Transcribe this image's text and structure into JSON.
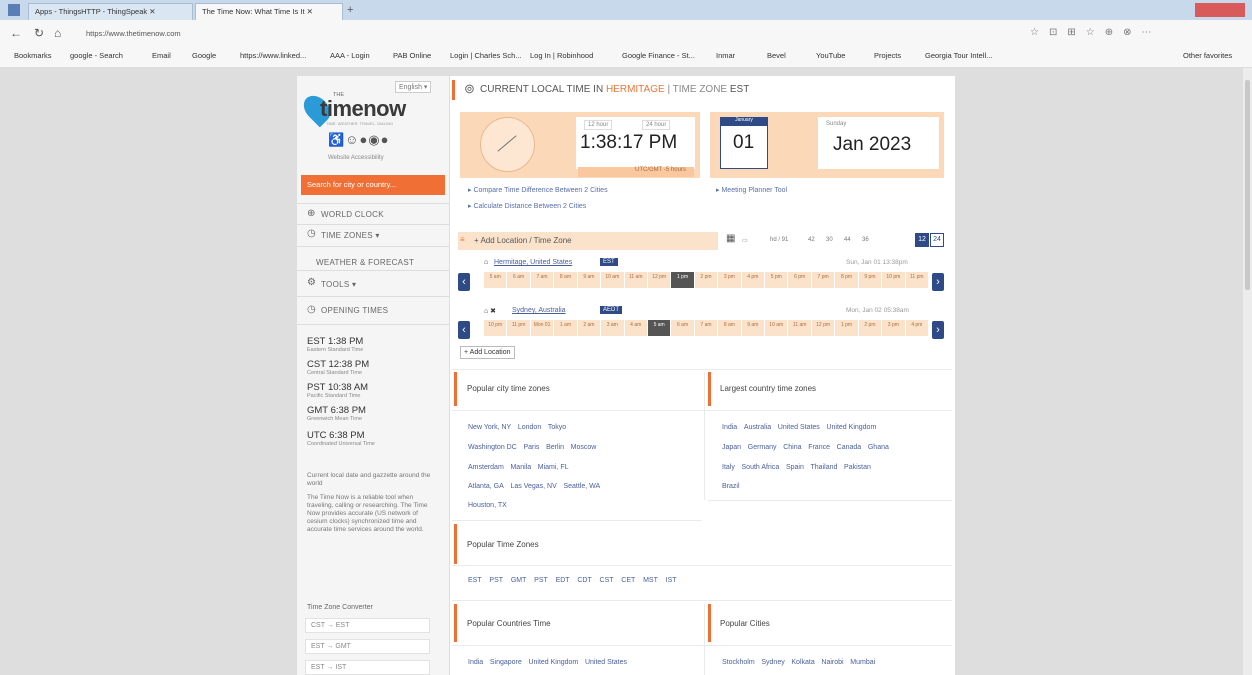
{
  "browser": {
    "tabs": [
      "Apps - ThingsHTTP - ThingSpeak",
      "The Time Now: What Time Is It"
    ],
    "address": "https://www.thetimenow.com",
    "bookmarks": [
      "Bookmarks",
      "google - Search",
      "Email",
      "Google",
      "https://www.linked...",
      "AAA - Login",
      "PAB Online",
      "Login | Charles Sch...",
      "Log In | Robinhood",
      "Google Finance - St...",
      "Inmar",
      "Bevel",
      "YouTube",
      "Projects",
      "Georgia Tour Intell...",
      "Other favorites"
    ]
  },
  "sidebar": {
    "language": "English",
    "logo_the": "THE",
    "logo_main": "timenow",
    "logo_tagline": "TIME. WEATHER. TRAVEL. DIALING",
    "accessibility": "Website Accessibility",
    "search_placeholder": "Search for city or country...",
    "menu": [
      "WORLD CLOCK",
      "TIME ZONES ▾",
      "WEATHER & FORECAST",
      "TOOLS ▾",
      "OPENING TIMES"
    ],
    "zones": [
      {
        "big": "EST 1:38 PM",
        "small": "Eastern Standard Time"
      },
      {
        "big": "CST 12:38 PM",
        "small": "Central Standard Time"
      },
      {
        "big": "PST 10:38 AM",
        "small": "Pacific Standard Time"
      },
      {
        "big": "GMT 6:38 PM",
        "small": "Greenwich Mean Time"
      },
      {
        "big": "UTC 6:38 PM",
        "small": "Coordinated Universal Time"
      }
    ],
    "para1": "Current local date and gazzette around the world",
    "para2": "The Time Now is a reliable tool when traveling, calling or researching. The Time Now provides accurate (US network of cesium clocks) synchronized time and accurate time services around the world.",
    "conv_title": "Time Zone Converter",
    "converters": [
      "CST → EST",
      "EST → GMT",
      "EST → IST"
    ]
  },
  "main": {
    "header_prefix": "CURRENT LOCAL TIME IN",
    "header_city": "HERMITAGE",
    "header_sep": "| TIME ZONE",
    "header_zone": "EST",
    "btn_12": "12 hour",
    "btn_24": "24 hour",
    "time": "1:38:17 PM",
    "utc_offset": "UTC/GMT -5 hours",
    "cal_month": "January",
    "cal_day": "01",
    "weekday": "Sunday",
    "date": "Jan 2023",
    "link_diff": "Compare Time Difference Between 2 Cities",
    "link_dist": "Calculate Distance Between 2 Cities",
    "link_planner": "Meeting Planner Tool",
    "add_location": "+ Add Location / Time Zone",
    "toolbar": [
      "hd / 91",
      "42",
      "30",
      "44",
      "36"
    ],
    "fmt_12": "12",
    "fmt_24": "24",
    "loc1_name": "Hermitage, United States",
    "loc1_badge": "EST",
    "loc1_date": "Sun, Jan 01 13:38pm",
    "loc1_hours": [
      "5 am",
      "6 am",
      "7 am",
      "8 am",
      "9 am",
      "10 am",
      "11 am",
      "12 pm",
      "1 pm",
      "2 pm",
      "3 pm",
      "4 pm",
      "5 pm",
      "6 pm",
      "7 pm",
      "8 pm",
      "9 pm",
      "10 pm",
      "11 pm"
    ],
    "loc1_active": 8,
    "loc2_name": "Sydney, Australia",
    "loc2_badge": "AEDT",
    "loc2_date": "Mon, Jan 02 05:38am",
    "loc2_hours": [
      "10 pm",
      "11 pm",
      "Mon 01",
      "1 am",
      "2 am",
      "3 am",
      "4 am",
      "5 am",
      "6 am",
      "7 am",
      "8 am",
      "9 am",
      "10 am",
      "11 am",
      "12 pm",
      "1 pm",
      "2 pm",
      "3 pm",
      "4 pm"
    ],
    "loc2_active": 7,
    "add_location_btn": "+ Add Location",
    "popular_city_title": "Popular city time zones",
    "popular_cities": [
      [
        "New York, NY",
        "London",
        "Tokyo"
      ],
      [
        "Washington DC",
        "Paris",
        "Berlin",
        "Moscow"
      ],
      [
        "Amsterdam",
        "Manila",
        "Miami, FL"
      ],
      [
        "Atlanta, GA",
        "Las Vegas, NV",
        "Seattle, WA"
      ],
      [
        "Houston, TX"
      ]
    ],
    "largest_title": "Largest country time zones",
    "largest": [
      [
        "India",
        "Australia",
        "United States",
        "United Kingdom"
      ],
      [
        "Japan",
        "Germany",
        "China",
        "France",
        "Canada",
        "Ghana"
      ],
      [
        "Italy",
        "South Africa",
        "Spain",
        "Thailand",
        "Pakistan"
      ],
      [
        "Brazil"
      ]
    ],
    "popular_tz_title": "Popular Time Zones",
    "popular_tz": [
      "EST",
      "PST",
      "GMT",
      "PST",
      "EDT",
      "CDT",
      "CST",
      "CET",
      "MST",
      "IST"
    ],
    "countries_title": "Popular Countries Time",
    "countries": [
      "India",
      "Singapore",
      "United Kingdom",
      "United States"
    ],
    "cities_title": "Popular Cities",
    "cities": [
      "Stockholm",
      "Sydney",
      "Kolkata",
      "Nairobi",
      "Mumbai"
    ]
  },
  "colors": {
    "accent": "#ef6f35",
    "navy": "#2e4a87",
    "peach": "#fbd8b8"
  }
}
